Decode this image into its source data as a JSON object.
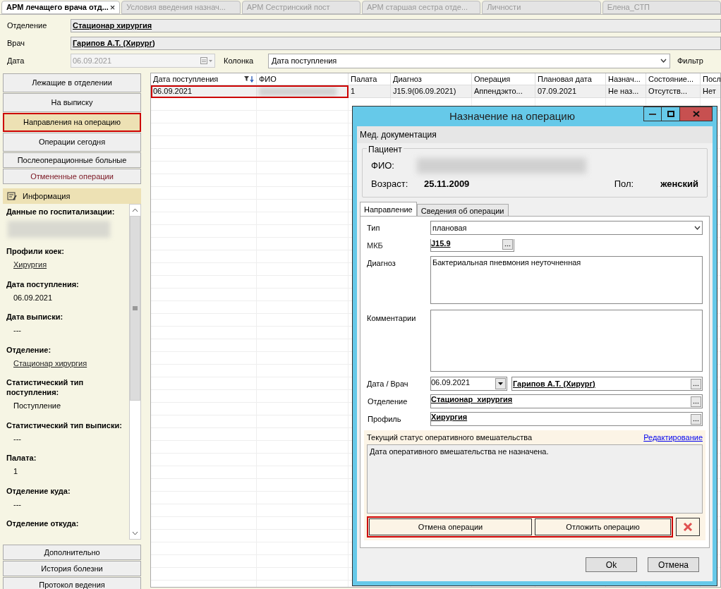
{
  "tabs": [
    {
      "label": "АРМ лечащего врача отд...",
      "selected": true,
      "close": "×"
    },
    {
      "label": "Условия введения назнач...",
      "selected": false
    },
    {
      "label": "АРМ Сестринский пост",
      "selected": false
    },
    {
      "label": "АРМ старшая сестра отде...",
      "selected": false
    },
    {
      "label": "Личности",
      "selected": false
    },
    {
      "label": "Елена_СТП",
      "selected": false
    }
  ],
  "header": {
    "department_label": "Отделение",
    "department": "Стационар  хирургия",
    "doctor_label": "Врач",
    "doctor": "Гарипов А.Т. (Хирург)",
    "date_label": "Дата",
    "date": "06.09.2021",
    "date_disabled": true,
    "column_label": "Колонка",
    "column": "Дата поступления",
    "filter_label": "Фильтр"
  },
  "nav": [
    {
      "label": "Лежащие в отделении",
      "selected": false
    },
    {
      "label": "На выписку",
      "selected": false
    },
    {
      "label": "Направления на операцию",
      "selected": true
    },
    {
      "label": "Операции сегодня",
      "selected": false
    },
    {
      "label": "Послеоперационные больные",
      "selected": false
    },
    {
      "label": "Отмененные операции",
      "selected": false,
      "kind": "cancelled"
    }
  ],
  "info": {
    "title": "Информация",
    "sections": [
      {
        "label": "Данные по госпитализации:",
        "kind": "redacted"
      },
      {
        "label": "Профили коек:",
        "value": "Хирургия",
        "kind": "link"
      },
      {
        "label": "Дата поступления:",
        "value": "06.09.2021",
        "kind": "text"
      },
      {
        "label": "Дата выписки:",
        "value": "---",
        "kind": "text"
      },
      {
        "label": "Отделение:",
        "value": "Стационар  хирургия",
        "kind": "link"
      },
      {
        "label": "Статистический тип поступления:",
        "value": "Поступление",
        "kind": "text"
      },
      {
        "label": "Статистический тип выписки:",
        "value": "---",
        "kind": "text"
      },
      {
        "label": "Палата:",
        "value": "1",
        "kind": "text"
      },
      {
        "label": "Отделение куда:",
        "value": "---",
        "kind": "text"
      },
      {
        "label": "Отделение откуда:",
        "kind": "text"
      }
    ]
  },
  "bottom_nav": [
    "Дополнительно",
    "История болезни",
    "Протокол ведения"
  ],
  "table": {
    "columns": [
      "Дата поступления",
      "ФИО",
      "Палата",
      "Диагноз",
      "Операция",
      "Плановая дата",
      "Назнач...",
      "Состояние...",
      "Посл"
    ],
    "rows": [
      {
        "marked": true,
        "cells": [
          "06.09.2021",
          null,
          "1",
          "J15.9(06.09.2021)",
          "Аппендэкто...",
          "07.09.2021",
          "Не наз...",
          "Отсутств...",
          "Нет"
        ]
      }
    ]
  },
  "dialog": {
    "title": "Назначение на операцию",
    "menu": "Мед. документация",
    "patient": {
      "group": "Пациент",
      "name_label": "ФИО:",
      "age_label": "Возраст:",
      "age": "25.11.2009",
      "sex_label": "Пол:",
      "sex": "женский"
    },
    "tabs": [
      {
        "label": "Направление",
        "selected": true
      },
      {
        "label": "Сведения об операции",
        "selected": false
      }
    ],
    "type_label": "Тип",
    "type": "плановая",
    "icd_label": "МКБ",
    "icd": "J15.9",
    "diagnosis_label": "Диагноз",
    "diagnosis": "Бактериальная пневмония неуточненная",
    "comments_label": "Комментарии",
    "date_doctor_label": "Дата / Врач",
    "date": "06.09.2021",
    "doctor": "Гарипов А.Т. (Хирург)",
    "department_label": "Отделение",
    "department": "Стационар  хирургия",
    "profile_label": "Профиль",
    "profile": "Хирургия",
    "status_label": "Текущий статус оперативного вмешательства",
    "edit_link": "Редактирование",
    "status": "Дата оперативного вмешательства не назначена.",
    "actions": {
      "marked": true,
      "buttons": [
        "Отмена операции",
        "Отложить операцию"
      ]
    },
    "ok": "Ok",
    "cancel": "Отмена"
  }
}
